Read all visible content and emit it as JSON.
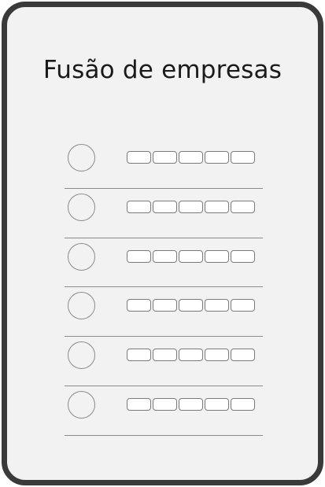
{
  "title": "Fusão de empresas",
  "rows": [
    {
      "slots": 5
    },
    {
      "slots": 5
    },
    {
      "slots": 5
    },
    {
      "slots": 5
    },
    {
      "slots": 5
    },
    {
      "slots": 5
    }
  ]
}
